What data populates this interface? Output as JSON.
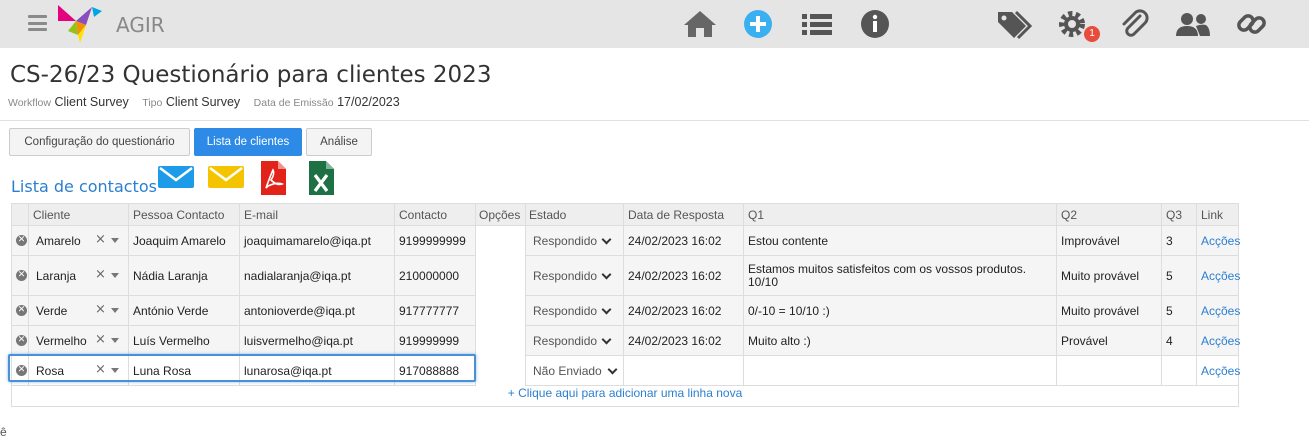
{
  "app": {
    "name": "AGIR",
    "notification_count": "1"
  },
  "toolbar_icons": [
    "home-icon",
    "add-circle-icon",
    "list-icon",
    "info-icon",
    "tags-icon",
    "settings-icon",
    "attachment-icon",
    "users-icon",
    "link-icon"
  ],
  "header": {
    "title": "CS-26/23 Questionário para clientes 2023",
    "workflow_label": "Workflow",
    "workflow_value": "Client Survey",
    "type_label": "Tipo",
    "type_value": "Client Survey",
    "date_label": "Data de Emissão",
    "date_value": "17/02/2023"
  },
  "tabs": [
    {
      "label": "Configuração do questionário",
      "active": false
    },
    {
      "label": "Lista de clientes",
      "active": true
    },
    {
      "label": "Análise",
      "active": false
    }
  ],
  "section_title": "Lista de contactos",
  "actions": [
    "email-blue-icon",
    "email-yellow-icon",
    "pdf-icon",
    "excel-icon"
  ],
  "colors": {
    "accent": "#2d8ae6",
    "link": "#2b7fd1",
    "pdf": "#e2231a",
    "excel": "#1e7145",
    "email_blue": "#1e9be8",
    "email_yellow": "#f5c400"
  },
  "table": {
    "columns": [
      "Cliente",
      "Pessoa Contacto",
      "E-mail",
      "Contacto",
      "Opções",
      "Estado",
      "Data de Resposta",
      "Q1",
      "Q2",
      "Q3",
      "Link"
    ],
    "rows": [
      {
        "cliente": "Amarelo",
        "pessoa": "Joaquim Amarelo",
        "email": "joaquimamarelo@iqa.pt",
        "contacto": "9199999999",
        "estado": "Respondido",
        "data": "24/02/2023 16:02",
        "q1": "Estou contente",
        "q2": "Improvável",
        "q3": "3",
        "link": "Acções"
      },
      {
        "cliente": "Laranja",
        "pessoa": "Nádia Laranja",
        "email": "nadialaranja@iqa.pt",
        "contacto": "210000000",
        "estado": "Respondido",
        "data": "24/02/2023 16:02",
        "q1": "Estamos muitos satisfeitos com os vossos produtos. 10/10",
        "q2": "Muito provável",
        "q3": "5",
        "link": "Acções"
      },
      {
        "cliente": "Verde",
        "pessoa": "António Verde",
        "email": "antonioverde@iqa.pt",
        "contacto": "917777777",
        "estado": "Respondido",
        "data": "24/02/2023 16:02",
        "q1": "0/-10 = 10/10 :)",
        "q2": "Muito provável",
        "q3": "5",
        "link": "Acções"
      },
      {
        "cliente": "Vermelho",
        "pessoa": "Luís Vermelho",
        "email": "luisvermelho@iqa.pt",
        "contacto": "919999999",
        "estado": "Respondido",
        "data": "24/02/2023 16:02",
        "q1": "Muito alto :)",
        "q2": "Provável",
        "q3": "4",
        "link": "Acções"
      },
      {
        "cliente": "Rosa",
        "pessoa": "Luna Rosa",
        "email": "lunarosa@iqa.pt",
        "contacto": "917088888",
        "estado": "Não Enviado",
        "data": "",
        "q1": "",
        "q2": "",
        "q3": "",
        "link": "Acções"
      }
    ],
    "add_row": "+ Clique aqui para adicionar uma linha nova"
  },
  "stray_char": "ê"
}
